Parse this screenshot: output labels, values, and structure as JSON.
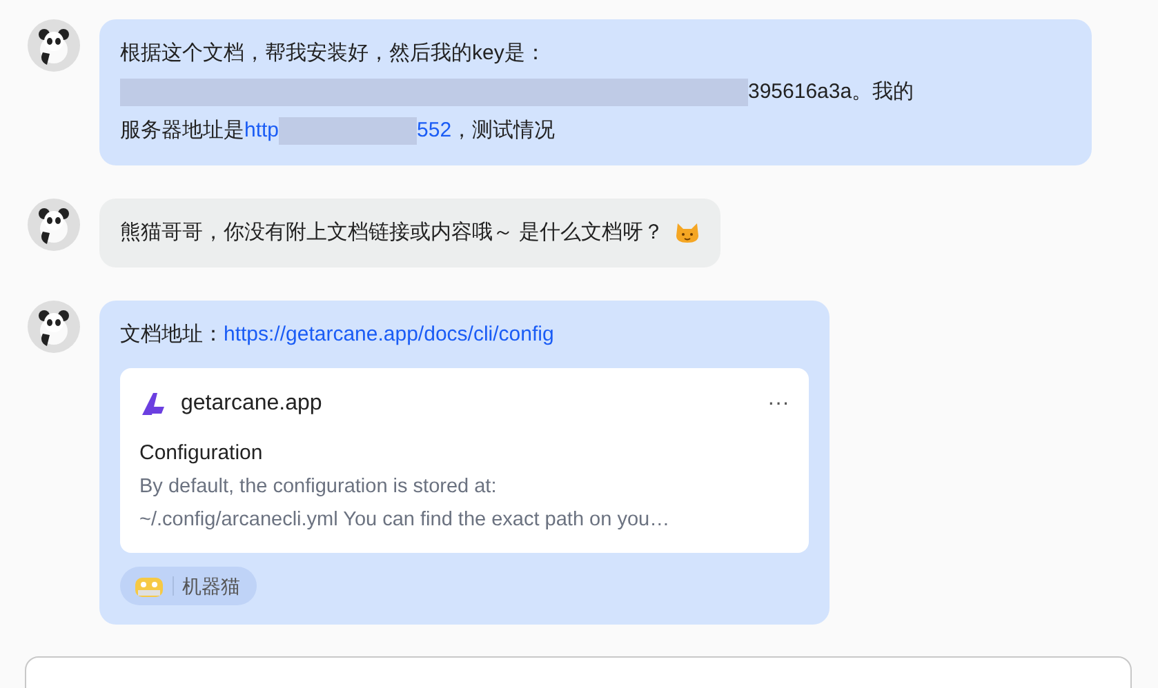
{
  "messages": [
    {
      "color": "#d3e3fd",
      "kind": "text",
      "lines": [
        [
          {
            "kind": "text",
            "text": "根据这个文档，帮我安装好，然后我的key是："
          }
        ],
        [
          {
            "kind": "redacted"
          },
          {
            "kind": "text",
            "text": "395616a3a。我的"
          }
        ],
        [
          {
            "kind": "text",
            "text": "服务器地址是"
          },
          {
            "kind": "link",
            "text": "http"
          },
          {
            "kind": "redacted"
          },
          {
            "kind": "link",
            "text": "552"
          },
          {
            "kind": "text",
            "text": "，测试情况"
          }
        ]
      ]
    },
    {
      "color": "#eceeee",
      "kind": "text",
      "lines": [
        [
          {
            "kind": "text",
            "text": "熊猫哥哥，你没有附上文档链接或内容哦～ 是什么文档呀？"
          },
          {
            "kind": "emoji"
          }
        ]
      ]
    },
    {
      "color": "#d3e3fd",
      "kind": "link_card",
      "lines": [
        [
          {
            "kind": "text",
            "text": "文档地址："
          },
          {
            "kind": "link",
            "text": "https://getarcane.app/docs/cli/config"
          }
        ]
      ],
      "card": {
        "site": "getarcane.app",
        "more": "···",
        "title": "Configuration",
        "lines": [
          "By default, the configuration is stored at:",
          "~/.config/arcanecli.yml You can find the exact path on you…"
        ]
      },
      "chip": {
        "label": "机器猫"
      }
    }
  ]
}
